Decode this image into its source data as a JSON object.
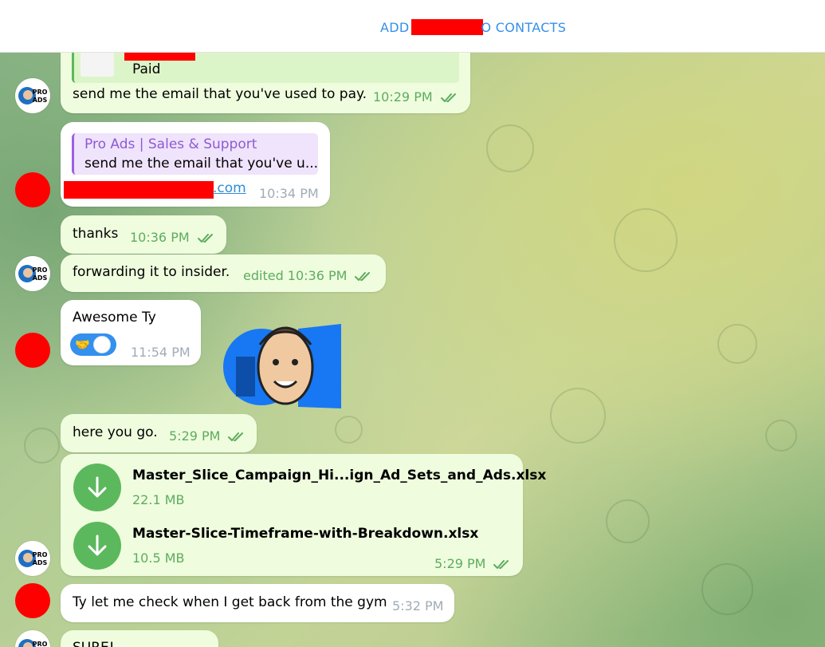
{
  "header": {
    "add_contacts_prefix": "ADD",
    "add_contacts_suffix": "O CONTACTS"
  },
  "messages": [
    {
      "id": "m1",
      "quote_text": "Paid",
      "text": "send me the email that you've used to pay.",
      "time": "10:29 PM",
      "direction": "out"
    },
    {
      "id": "m2",
      "reply_name": "Pro Ads | Sales & Support",
      "reply_text": "send me the email that you've u...",
      "link_tail": ".com",
      "time": "10:34 PM",
      "direction": "in"
    },
    {
      "id": "m3",
      "text": "thanks",
      "time": "10:36 PM",
      "direction": "out"
    },
    {
      "id": "m4",
      "text": "forwarding it to insider.",
      "time": "edited 10:36 PM",
      "direction": "out"
    },
    {
      "id": "m5",
      "text": "Awesome Ty",
      "reaction": "🤝",
      "time": "11:54 PM",
      "direction": "in"
    },
    {
      "id": "m6",
      "text": "here you go.",
      "time": "5:29 PM",
      "direction": "out"
    },
    {
      "id": "m7",
      "files": [
        {
          "name": "Master_Slice_Campaign_Hi...ign_Ad_Sets_and_Ads.xlsx",
          "size": "22.1 MB"
        },
        {
          "name": "Master-Slice-Timeframe-with-Breakdown.xlsx",
          "size": "10.5 MB"
        }
      ],
      "time": "5:29 PM",
      "direction": "out"
    },
    {
      "id": "m8",
      "text": "Ty let me check when I get back from the gym",
      "time": "5:32 PM",
      "direction": "in"
    },
    {
      "id": "m9",
      "text": "SURE!",
      "direction": "out"
    }
  ],
  "avatar_text": {
    "line1": "PRO",
    "line2": "ADS"
  },
  "colors": {
    "accent": "#3390ec",
    "outgoing_bubble": "#effdde",
    "incoming_bubble": "#ffffff",
    "time_out": "#5dac5f",
    "time_in": "#a0acb6",
    "redaction": "#ff0000",
    "file_icon": "#5cb85d"
  },
  "icons": [
    "double-check-icon",
    "download-icon",
    "handshake-icon",
    "sticker-image",
    "pro-ads-avatar"
  ]
}
